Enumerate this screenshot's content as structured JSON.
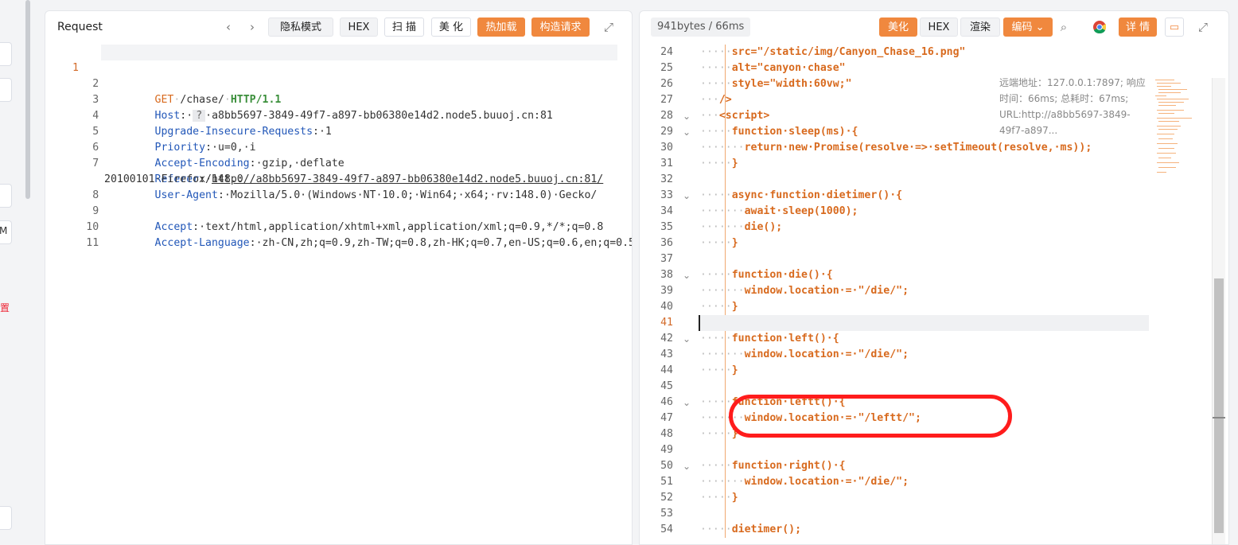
{
  "left_strip": {
    "m_text": "M",
    "red_text": "置"
  },
  "request": {
    "title": "Request",
    "buttons": {
      "privacy": "隐私模式",
      "hex": "HEX",
      "scan": "扫 描",
      "beautify": "美 化",
      "hot_reload": "热加载",
      "build_request": "构造请求"
    },
    "lines": [
      {
        "n": "1",
        "method": "GET",
        "path": "/chase/",
        "proto": "HTTP/1.1"
      },
      {
        "n": "2",
        "key": "Host",
        "q": "?",
        "val": "a8bb5697-3849-49f7-a897-bb06380e14d2.node5.buuoj.cn:81"
      },
      {
        "n": "3",
        "key": "Upgrade-Insecure-Requests",
        "val": "1"
      },
      {
        "n": "4",
        "key": "Priority",
        "val": "u=0,·i"
      },
      {
        "n": "5",
        "key": "Accept-Encoding",
        "val": "gzip,·deflate"
      },
      {
        "n": "6",
        "key": "Referer",
        "val": "http://a8bb5697-3849-49f7-a897-bb06380e14d2.node5.buuoj.cn:81/"
      },
      {
        "n": "7",
        "key": "User-Agent",
        "val": "Mozilla/5.0·(Windows·NT·10.0;·Win64;·x64;·rv:148.0)·Gecko/",
        "val2": "20100101·Firefox/148.0"
      },
      {
        "n": "8",
        "key": "Accept",
        "val": "text/html,application/xhtml+xml,application/xml;q=0.9,*/*;q=0.8"
      },
      {
        "n": "9",
        "key": "Accept-Language",
        "val": "zh-CN,zh;q=0.9,zh-TW;q=0.8,zh-HK;q=0.7,en-US;q=0.6,en;q=0.5"
      },
      {
        "n": "10"
      },
      {
        "n": "11"
      }
    ]
  },
  "response": {
    "size_badge": "941bytes / 66ms",
    "buttons": {
      "beautify": "美化",
      "hex": "HEX",
      "render": "渲染",
      "encoding": "编码",
      "details": "详 情"
    },
    "remote_info": "远端地址：127.0.0.1:7897; 响应时间：66ms; 总耗时：67ms; URL:http://a8bb5697-3849-49f7-a897...",
    "lines": [
      {
        "n": "24",
        "dots": "·····",
        "text": "src=\"/static/img/Canyon_Chase_16.png\""
      },
      {
        "n": "25",
        "dots": "·····",
        "text": "alt=\"canyon·chase\""
      },
      {
        "n": "26",
        "dots": "·····",
        "text": "style=\"width:60vw;\""
      },
      {
        "n": "27",
        "dots": "···",
        "text": "/>"
      },
      {
        "n": "28",
        "dots": "···",
        "text": "<script>",
        "fold": true
      },
      {
        "n": "29",
        "dots": "·····",
        "text": "function·sleep(ms)·{",
        "fold": true
      },
      {
        "n": "30",
        "dots": "·······",
        "text": "return·new·Promise(resolve·=>·setTimeout(resolve,·ms));"
      },
      {
        "n": "31",
        "dots": "·····",
        "text": "}"
      },
      {
        "n": "32",
        "dots": "",
        "text": ""
      },
      {
        "n": "33",
        "dots": "·····",
        "text": "async·function·dietimer()·{",
        "fold": true
      },
      {
        "n": "34",
        "dots": "·······",
        "text": "await·sleep(1000);"
      },
      {
        "n": "35",
        "dots": "·······",
        "text": "die();"
      },
      {
        "n": "36",
        "dots": "·····",
        "text": "}"
      },
      {
        "n": "37",
        "dots": "",
        "text": ""
      },
      {
        "n": "38",
        "dots": "·····",
        "text": "function·die()·{",
        "fold": true
      },
      {
        "n": "39",
        "dots": "·······",
        "text": "window.location·=·\"/die/\";"
      },
      {
        "n": "40",
        "dots": "·····",
        "text": "}"
      },
      {
        "n": "41",
        "dots": "",
        "text": "",
        "active": true
      },
      {
        "n": "42",
        "dots": "·····",
        "text": "function·left()·{",
        "fold": true
      },
      {
        "n": "43",
        "dots": "·······",
        "text": "window.location·=·\"/die/\";"
      },
      {
        "n": "44",
        "dots": "·····",
        "text": "}"
      },
      {
        "n": "45",
        "dots": "",
        "text": ""
      },
      {
        "n": "46",
        "dots": "·····",
        "text": "function·leftt()·{",
        "fold": true
      },
      {
        "n": "47",
        "dots": "·······",
        "text": "window.location·=·\"/leftt/\";"
      },
      {
        "n": "48",
        "dots": "·····",
        "text": "}"
      },
      {
        "n": "49",
        "dots": "",
        "text": ""
      },
      {
        "n": "50",
        "dots": "·····",
        "text": "function·right()·{",
        "fold": true
      },
      {
        "n": "51",
        "dots": "·······",
        "text": "window.location·=·\"/die/\";"
      },
      {
        "n": "52",
        "dots": "·····",
        "text": "}"
      },
      {
        "n": "53",
        "dots": "",
        "text": ""
      },
      {
        "n": "54",
        "dots": "·····",
        "text": "dietimer();"
      }
    ]
  },
  "colors": {
    "accent_orange": "#f0883e",
    "annotation_red": "#ff1c1c",
    "code_orange": "#d86a1e",
    "header_blue": "#2257b8"
  }
}
